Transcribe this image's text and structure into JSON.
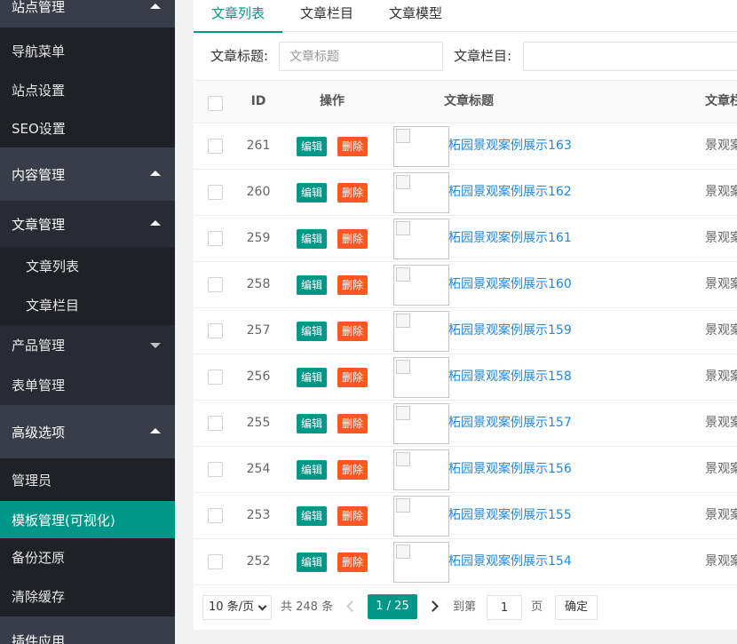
{
  "sidebar": {
    "groups": [
      {
        "label": "站点管理"
      },
      {
        "label": "内容管理"
      },
      {
        "label": "高级选项"
      },
      {
        "label": "插件应用"
      }
    ],
    "items": [
      {
        "label": "导航菜单"
      },
      {
        "label": "站点设置"
      },
      {
        "label": "SEO设置"
      },
      {
        "label": "文章管理"
      },
      {
        "label": "文章列表"
      },
      {
        "label": "文章栏目"
      },
      {
        "label": "产品管理"
      },
      {
        "label": "表单管理"
      },
      {
        "label": "管理员"
      },
      {
        "label": "模板管理(可视化)"
      },
      {
        "label": "备份还原"
      },
      {
        "label": "清除缓存"
      }
    ]
  },
  "tabs": [
    {
      "label": "文章列表"
    },
    {
      "label": "文章栏目"
    },
    {
      "label": "文章模型"
    }
  ],
  "filters": {
    "title_label": "文章标题:",
    "title_placeholder": "文章标题",
    "category_label": "文章栏目:"
  },
  "table": {
    "headers": {
      "id": "ID",
      "actions": "操作",
      "title": "文章标题",
      "category": "文章栏"
    },
    "edit_label": "编辑",
    "delete_label": "删除",
    "rows": [
      {
        "id": "261",
        "title": "柘园景观案例展示163",
        "category": "景观案"
      },
      {
        "id": "260",
        "title": "柘园景观案例展示162",
        "category": "景观案"
      },
      {
        "id": "259",
        "title": "柘园景观案例展示161",
        "category": "景观案"
      },
      {
        "id": "258",
        "title": "柘园景观案例展示160",
        "category": "景观案"
      },
      {
        "id": "257",
        "title": "柘园景观案例展示159",
        "category": "景观案"
      },
      {
        "id": "256",
        "title": "柘园景观案例展示158",
        "category": "景观案"
      },
      {
        "id": "255",
        "title": "柘园景观案例展示157",
        "category": "景观案"
      },
      {
        "id": "254",
        "title": "柘园景观案例展示156",
        "category": "景观案"
      },
      {
        "id": "253",
        "title": "柘园景观案例展示155",
        "category": "景观案"
      },
      {
        "id": "252",
        "title": "柘园景观案例展示154",
        "category": "景观案"
      }
    ]
  },
  "pagination": {
    "page_size": "10 条/页",
    "total": "共 248 条",
    "current": "1 / 25",
    "goto_label": "到第",
    "goto_value": "1",
    "page_suffix": "页",
    "confirm": "确定"
  },
  "colors": {
    "accent": "#009688",
    "danger": "#ff5722",
    "link": "#1e88e5",
    "sidebar_bg": "#393d49"
  }
}
